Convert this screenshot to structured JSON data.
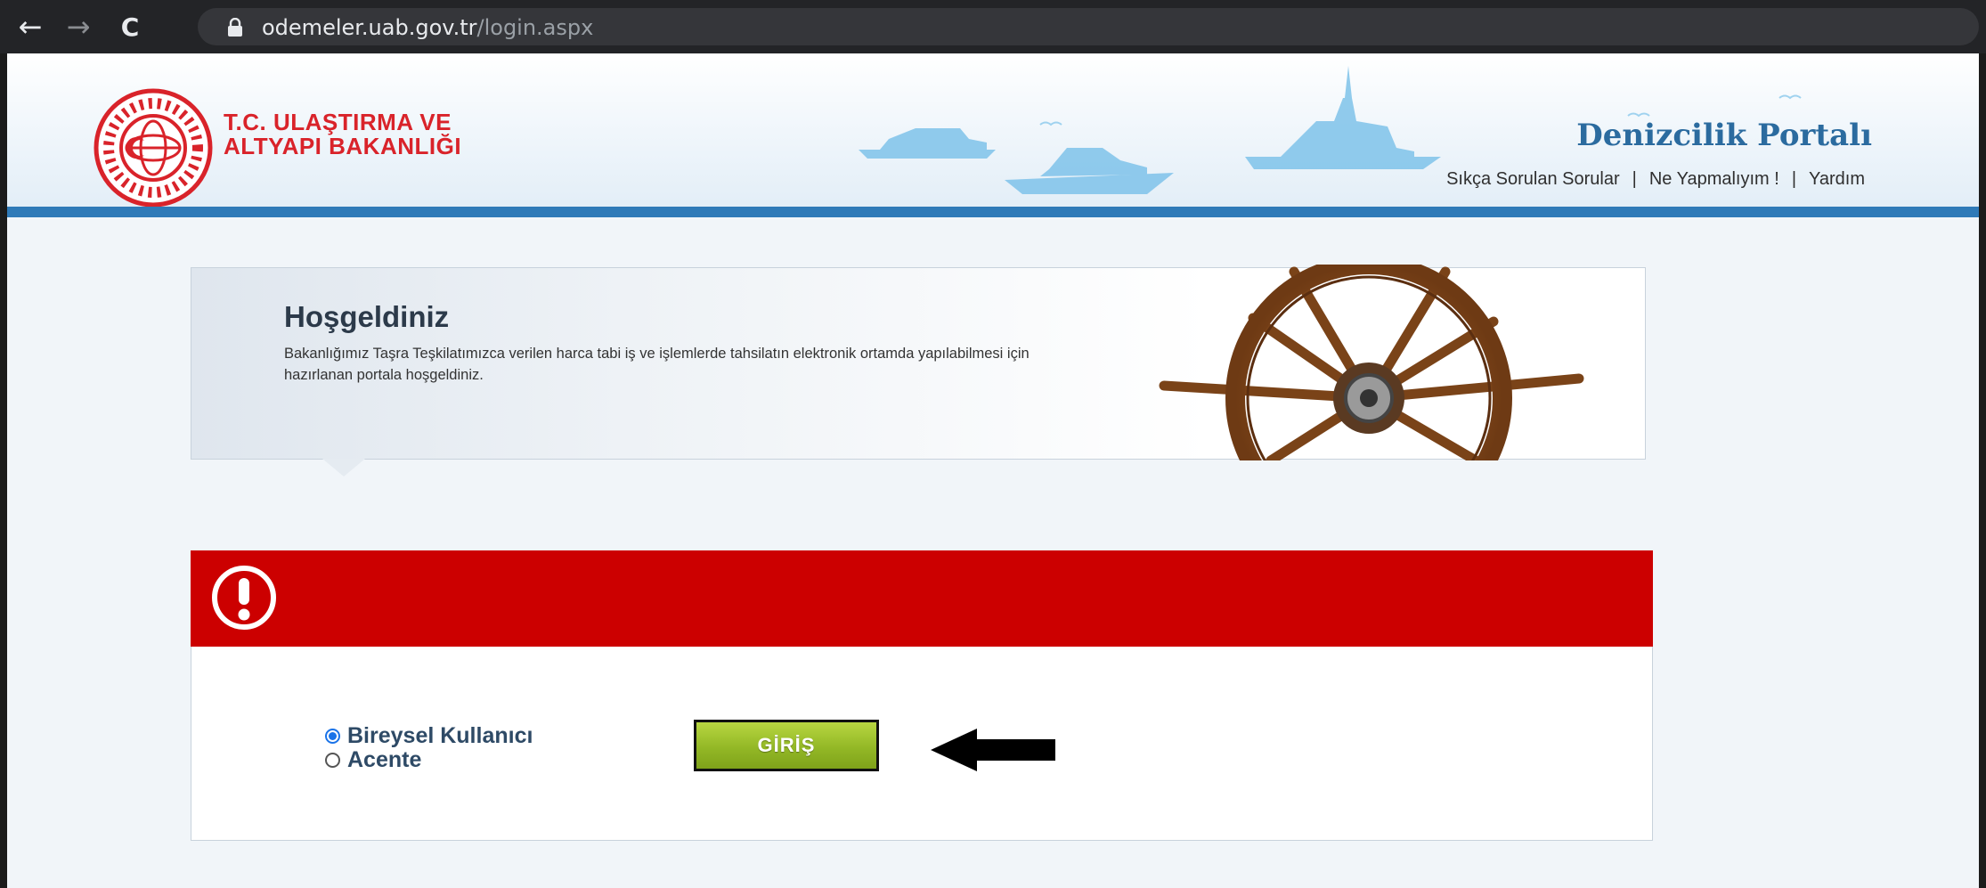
{
  "browser": {
    "back_icon": "arrow-left-icon",
    "forward_icon": "arrow-right-icon",
    "reload_icon": "reload-icon",
    "url_host": "odemeler.uab.gov.tr",
    "url_path": "/login.aspx",
    "back_glyph": "←",
    "forward_glyph": "→",
    "reload_glyph": "C"
  },
  "header": {
    "ministry_line1": "T.C. ULAŞTIRMA VE",
    "ministry_line2": "ALTYAPI BAKANLIĞI",
    "portal_title": "Denizcilik Portalı",
    "links": [
      "Sıkça Sorulan Sorular",
      "Ne Yapmalıyım !",
      "Yardım"
    ],
    "separator": "|",
    "colors": {
      "brand_red": "#d9232a",
      "portal_blue": "#2b6b9f",
      "bar_blue": "#2f7ab8"
    }
  },
  "welcome": {
    "title": "Hoşgeldiniz",
    "text": "Bakanlığımız Taşra Teşkilatımızca verilen harca tabi iş ve işlemlerde tahsilatın elektronik ortamda yapılabilmesi için hazırlanan portala hoşgeldiniz."
  },
  "login": {
    "alert_icon": "exclamation-circle-icon",
    "alert_color": "#cc0000",
    "options": [
      {
        "label": "Bireysel Kullanıcı",
        "selected": true
      },
      {
        "label": "Acente",
        "selected": false
      }
    ],
    "button_label": "GİRİŞ",
    "button_color": "#93b826"
  },
  "annotation": {
    "icon": "black-arrow-left-icon"
  }
}
